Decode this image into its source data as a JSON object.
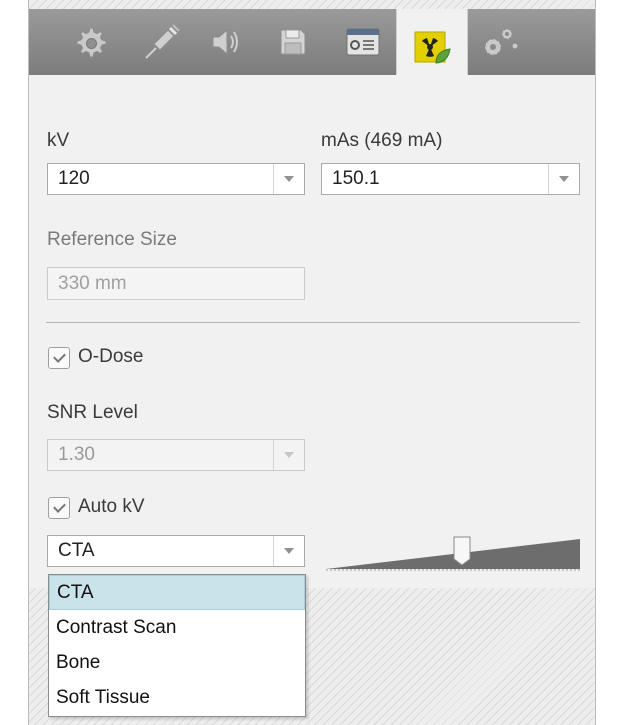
{
  "toolbar": {
    "tabs": [
      {
        "icon": "gear-icon"
      },
      {
        "icon": "injector-icon"
      },
      {
        "icon": "speaker-icon"
      },
      {
        "icon": "save-icon"
      },
      {
        "icon": "protocol-card-icon"
      },
      {
        "icon": "radiation-dose-icon",
        "active": true
      },
      {
        "icon": "advanced-settings-icon"
      }
    ]
  },
  "kv": {
    "label": "kV",
    "value": "120"
  },
  "mas": {
    "label": "mAs (469 mA)",
    "value": "150.1"
  },
  "reference_size": {
    "label": "Reference Size",
    "value": "330  mm"
  },
  "odose": {
    "label": "O-Dose",
    "checked": true
  },
  "snr": {
    "label": "SNR Level",
    "value": "1.30"
  },
  "auto_kv": {
    "label": "Auto kV",
    "checked": true
  },
  "exam_type": {
    "value": "CTA",
    "options": [
      "CTA",
      "Contrast Scan",
      "Bone",
      "Soft Tissue"
    ],
    "selected_index": 0
  },
  "colors": {
    "accent_selected": "#c8e3ea",
    "active_tab_icon": "#d6c400"
  }
}
